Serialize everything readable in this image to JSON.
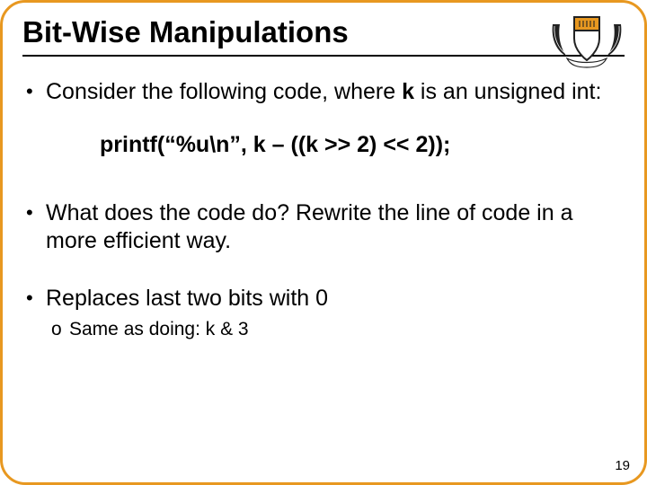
{
  "title": "Bit-Wise Manipulations",
  "logo_name": "princeton-shield-logo",
  "bullets": {
    "b1_pre": "Consider the following code, where ",
    "b1_bold": "k",
    "b1_post": " is an unsigned int:",
    "code": "printf(“%u\\n”, k – ((k >> 2) << 2));",
    "b2": "What does the code do? Rewrite the line of code in a more efficient way.",
    "b3": "Replaces last two bits with 0",
    "sub1": "Same as doing: k & 3"
  },
  "page_number": "19"
}
